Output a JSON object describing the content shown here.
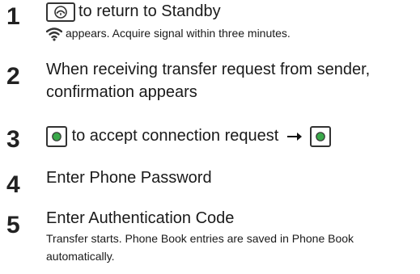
{
  "steps": [
    {
      "number": "1",
      "key_icon": "end-call-key-icon",
      "text": "to return to Standby",
      "note_icon": "signal-icon",
      "note": "appears. Acquire signal within three minutes."
    },
    {
      "number": "2",
      "text_line1": "When receiving transfer request from sender,",
      "text_line2": "confirmation appears"
    },
    {
      "number": "3",
      "key_icon": "center-select-key-icon",
      "text": "to accept connection request",
      "arrow_icon": "right-arrow-icon",
      "key_icon2": "center-select-key-icon"
    },
    {
      "number": "4",
      "text": "Enter Phone Password"
    },
    {
      "number": "5",
      "text": "Enter Authentication Code",
      "note_line1": "Transfer starts. Phone Book entries are saved in Phone Book",
      "note_line2": "automatically."
    }
  ],
  "colors": {
    "text": "#1a1a1a",
    "key_border": "#333333",
    "select_key_fill": "#3aa84a"
  }
}
